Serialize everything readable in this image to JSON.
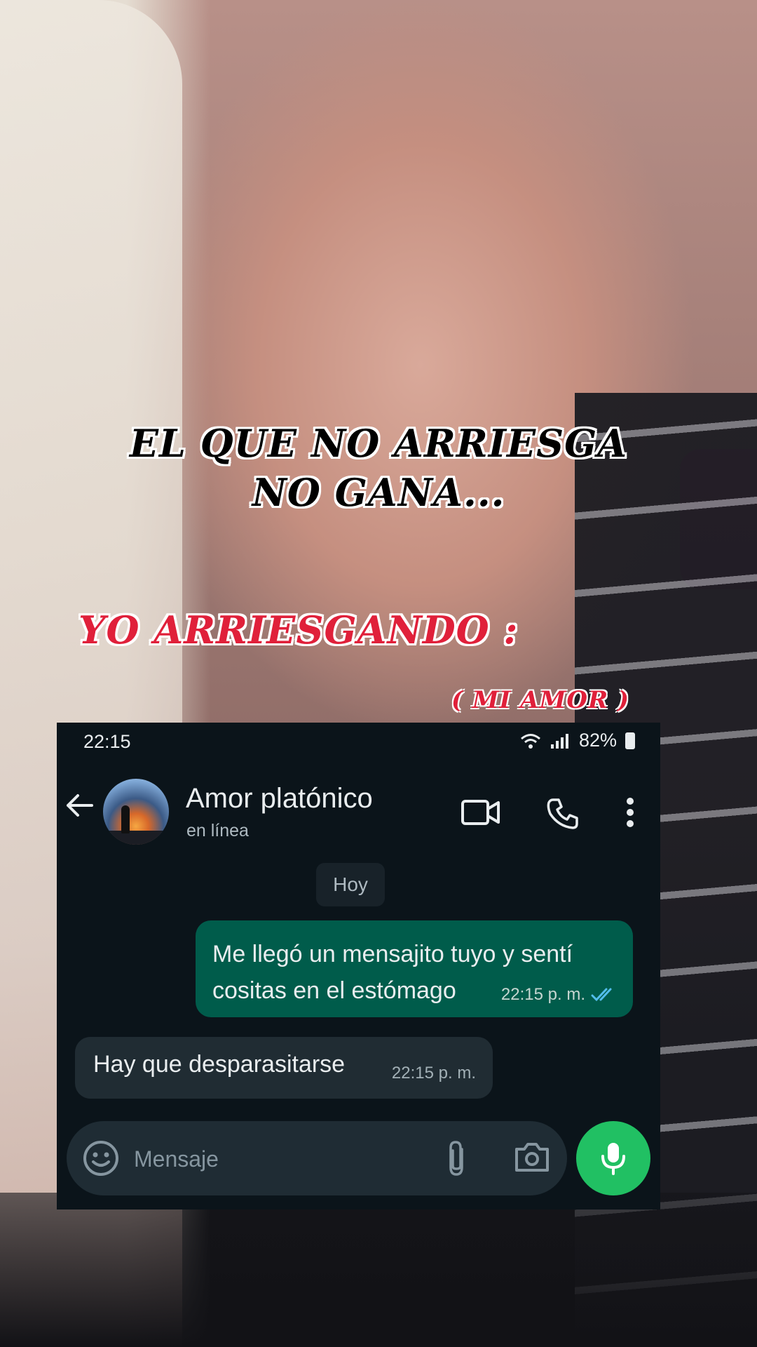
{
  "overlay": {
    "line1": "EL QUE NO ARRIESGA",
    "line2": "NO GANA...",
    "yo": "YO ARRIESGANDO :",
    "mi_amor": "( MI AMOR )"
  },
  "status_bar": {
    "time": "22:15",
    "battery": "82%"
  },
  "chat_header": {
    "contact_name": "Amor platónico",
    "status": "en línea"
  },
  "date_chip": "Hoy",
  "messages": [
    {
      "direction": "outgoing",
      "text": "Me llegó un mensajito tuyo y sentí cositas en el estómago",
      "time": "22:15 p. m."
    },
    {
      "direction": "incoming",
      "text": "Hay que desparasitarse",
      "time": "22:15 p. m."
    }
  ],
  "composer": {
    "placeholder": "Mensaje"
  },
  "colors": {
    "outgoing_bubble": "#005c4b",
    "incoming_bubble": "#202c33",
    "mic_button": "#21c063",
    "caption_red": "#e0203a"
  }
}
